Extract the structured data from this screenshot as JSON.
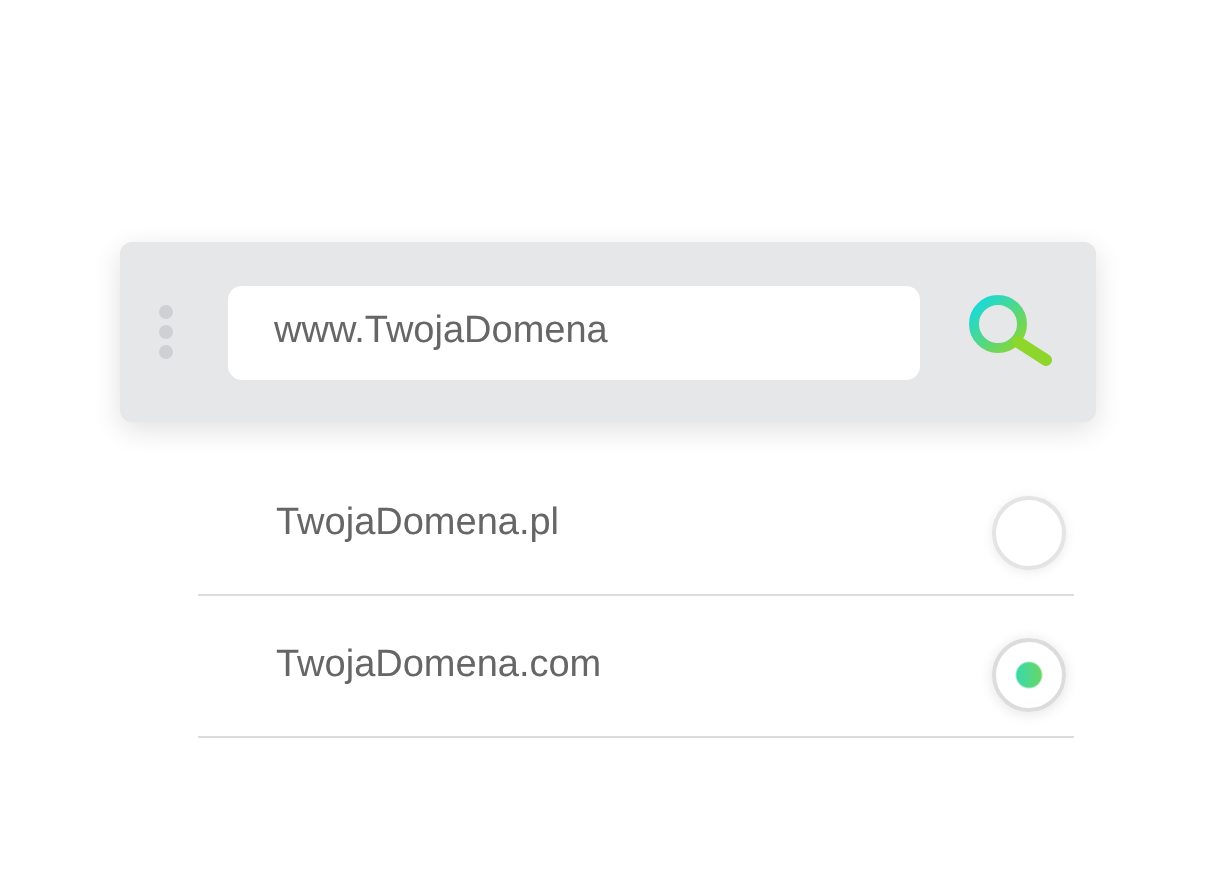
{
  "search": {
    "value": "www.TwojaDomena"
  },
  "domains": [
    {
      "name": "TwojaDomena.pl",
      "selected": false
    },
    {
      "name": "TwojaDomena.com",
      "selected": true
    }
  ]
}
